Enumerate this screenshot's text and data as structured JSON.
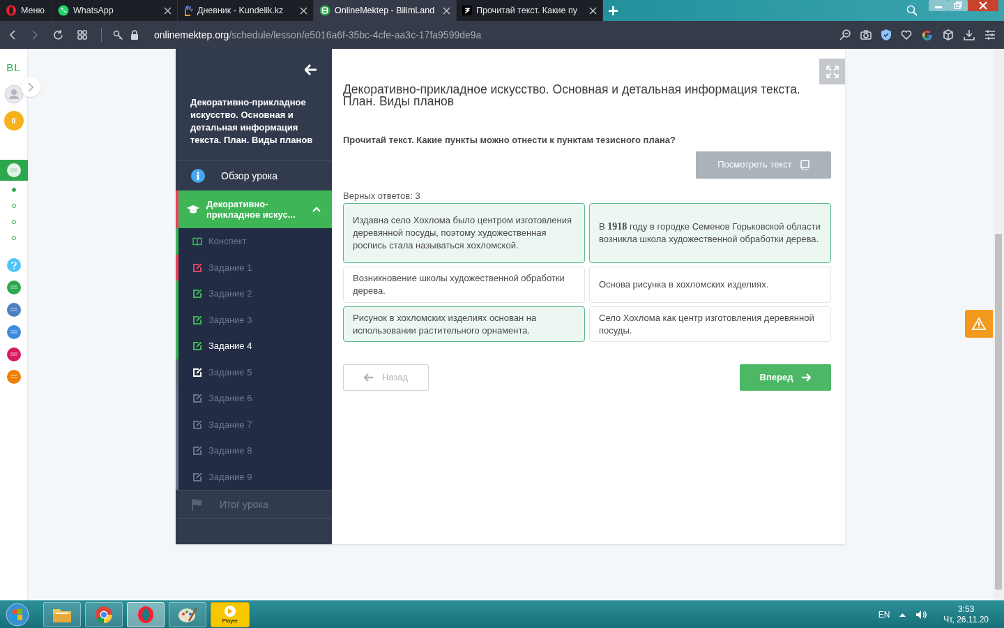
{
  "browser": {
    "tabs": [
      {
        "label": "Меню",
        "kind": "menu",
        "selected": false
      },
      {
        "label": "WhatsApp",
        "kind": "whatsapp",
        "selected": false
      },
      {
        "label": "Дневник - Kundelik.kz",
        "kind": "kundelik",
        "selected": false
      },
      {
        "label": "OnlineMektep - BilimLand",
        "kind": "bilimland",
        "selected": true
      },
      {
        "label": "Прочитай текст. Какие пу",
        "kind": "znanija",
        "selected": false
      }
    ],
    "url_host": "onlinemektep.org",
    "url_path": "/schedule/lesson/e5016a6f-35bc-4cfe-aa3c-17fa9599de9a"
  },
  "rail": {
    "logo": "BL",
    "coins": "0",
    "steps": [
      {
        "selected": true
      },
      {
        "selected": false
      },
      {
        "selected": false
      },
      {
        "selected": false
      }
    ],
    "apps": [
      {
        "color": "#4fc3f7",
        "kind": "help"
      },
      {
        "color": "#2ea84f"
      },
      {
        "color": "#4a7fc1"
      },
      {
        "color": "#3d8be0"
      },
      {
        "color": "#d81b60"
      },
      {
        "color": "#ef7d00"
      }
    ]
  },
  "lesson_nav": {
    "title": "Декоративно-прикладное искусство. Основная и детальная информация текста. План. Виды планов",
    "overview": "Обзор урока",
    "section": {
      "label": "Декоративно-прикладное искус...",
      "expanded": true
    },
    "items": [
      {
        "label": "Конспект",
        "kind": "notes",
        "color": "#3eb656",
        "selected": false
      },
      {
        "label": "Задание 1",
        "kind": "task",
        "color": "#e5445f",
        "selected": false
      },
      {
        "label": "Задание 2",
        "kind": "task",
        "color": "#3eb656",
        "selected": false
      },
      {
        "label": "Задание 3",
        "kind": "task",
        "color": "#3eb656",
        "selected": false
      },
      {
        "label": "Задание 4",
        "kind": "task",
        "color": "#3eb656",
        "selected": true
      },
      {
        "label": "Задание 5",
        "kind": "task",
        "color": "#ffffff",
        "selected": false
      },
      {
        "label": "Задание 6",
        "kind": "task",
        "color": "#6b7386",
        "selected": false
      },
      {
        "label": "Задание 7",
        "kind": "task",
        "color": "#6b7386",
        "selected": false
      },
      {
        "label": "Задание 8",
        "kind": "task",
        "color": "#6b7386",
        "selected": false
      },
      {
        "label": "Задание 9",
        "kind": "task",
        "color": "#6b7386",
        "selected": false
      }
    ],
    "summary": "Итог урока"
  },
  "main": {
    "heading": "Декоративно-прикладное искусство. Основная и детальная информация текста. План. Виды планов",
    "question": "Прочитай текст. Какие пункты можно отнести к пунктам тезисного плана?",
    "view_text_button": "Посмотреть текст",
    "correct_count": "Верных ответов: 3",
    "options": [
      {
        "text": "Издавна село Хохлома было центром изготовления деревянной посуды, поэтому художественная роспись стала называться хохломской.",
        "selected": true
      },
      {
        "text": "В **1918** году в городке Семенов Горьковской области возникла школа художественной обработки дерева.",
        "selected": true
      },
      {
        "text": "Возникновение школы художественной обработки дерева.",
        "selected": false
      },
      {
        "text": "Основа рисунка в хохломских изделиях.",
        "selected": false
      },
      {
        "text": "Рисунок в хохломских изделиях основан на использовании растительного орнамента.",
        "selected": true
      },
      {
        "text": "Село Хохлома как центр изготовления деревянной посуды.",
        "selected": false
      }
    ],
    "back_button": {
      "label": "Назад",
      "disabled": true
    },
    "next_button": "Вперед"
  },
  "taskbar": {
    "apps": [
      {
        "kind": "start"
      },
      {
        "kind": "files"
      },
      {
        "kind": "chrome"
      },
      {
        "kind": "opera",
        "selected": true
      },
      {
        "kind": "paint"
      },
      {
        "kind": "player",
        "label": "Player"
      }
    ],
    "language": "EN",
    "time": "3:53",
    "date": "Чт, 26.11.20"
  }
}
